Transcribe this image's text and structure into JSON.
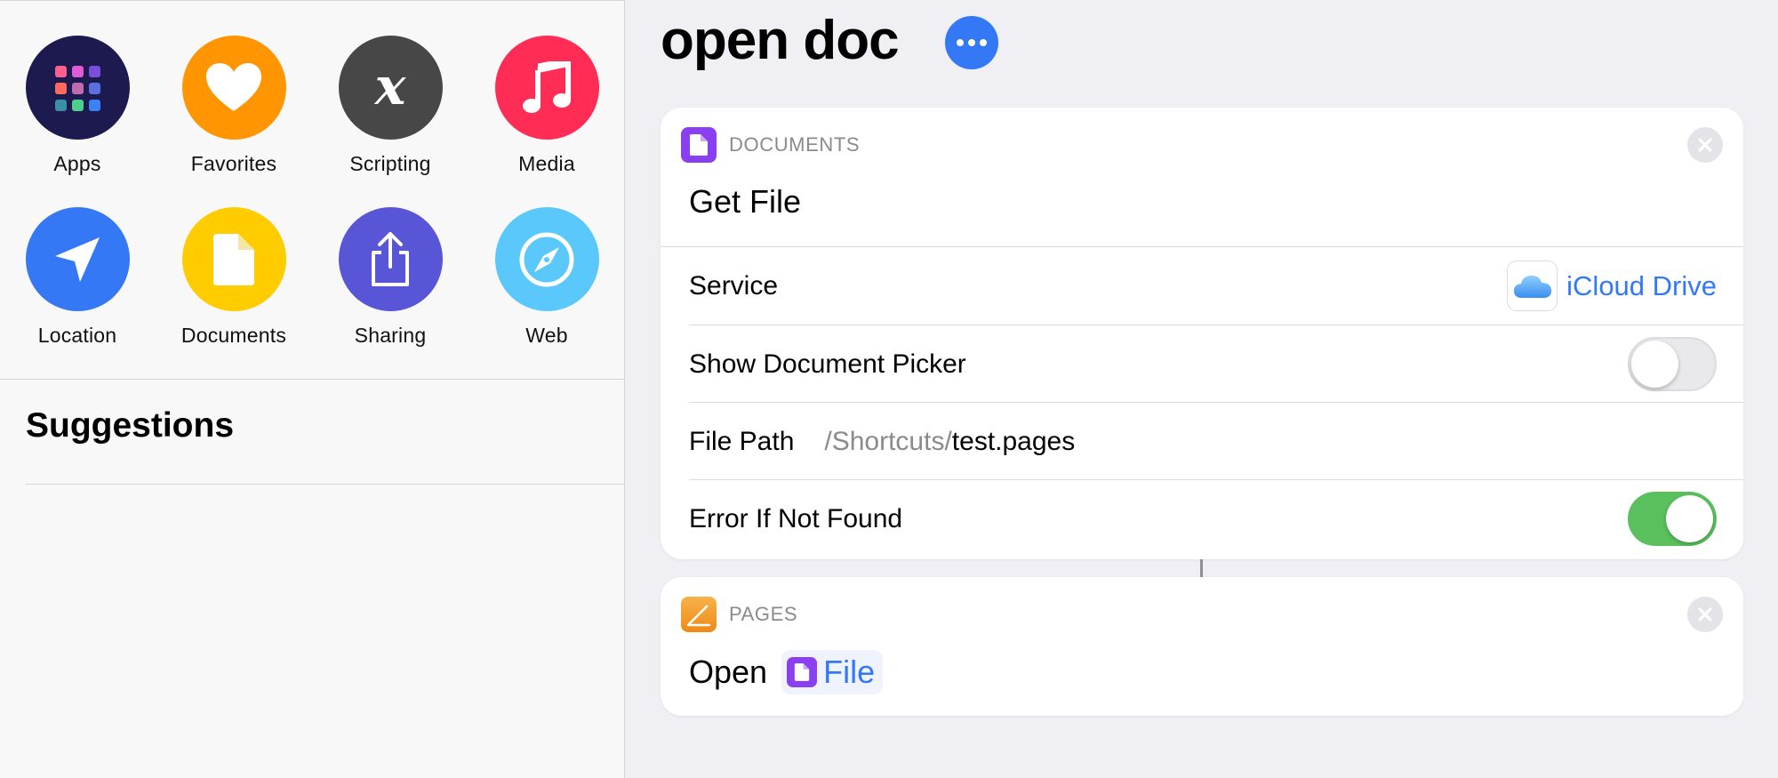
{
  "categories": [
    {
      "label": "Apps",
      "icon": "apps-grid-icon",
      "color": "#1c1a4f"
    },
    {
      "label": "Favorites",
      "icon": "heart-icon",
      "color": "#ff9500"
    },
    {
      "label": "Scripting",
      "icon": "variable-x-icon",
      "color": "#474747"
    },
    {
      "label": "Media",
      "icon": "music-note-icon",
      "color": "#ff2d55"
    },
    {
      "label": "Location",
      "icon": "location-arrow-icon",
      "color": "#3478f6"
    },
    {
      "label": "Documents",
      "icon": "document-icon",
      "color": "#ffcc00"
    },
    {
      "label": "Sharing",
      "icon": "share-icon",
      "color": "#5856d6"
    },
    {
      "label": "Web",
      "icon": "compass-icon",
      "color": "#5ac8fa"
    }
  ],
  "suggestions": {
    "title": "Suggestions"
  },
  "shortcut": {
    "title": "open doc"
  },
  "actions": [
    {
      "category": "DOCUMENTS",
      "category_icon_color": "#8a3ff0",
      "title": "Get File",
      "params": {
        "service": {
          "label": "Service",
          "value": "iCloud Drive"
        },
        "show_picker": {
          "label": "Show Document Picker",
          "on": false
        },
        "file_path": {
          "label": "File Path",
          "prefix": "/Shortcuts/",
          "value": "test.pages"
        },
        "error_if_not_found": {
          "label": "Error If Not Found",
          "on": true
        }
      }
    },
    {
      "category": "PAGES",
      "category_icon_color": "#f39c1e",
      "verb": "Open",
      "variable": "File"
    }
  ],
  "colors": {
    "accent": "#3478f6",
    "toggle_on": "#5ac05e"
  }
}
